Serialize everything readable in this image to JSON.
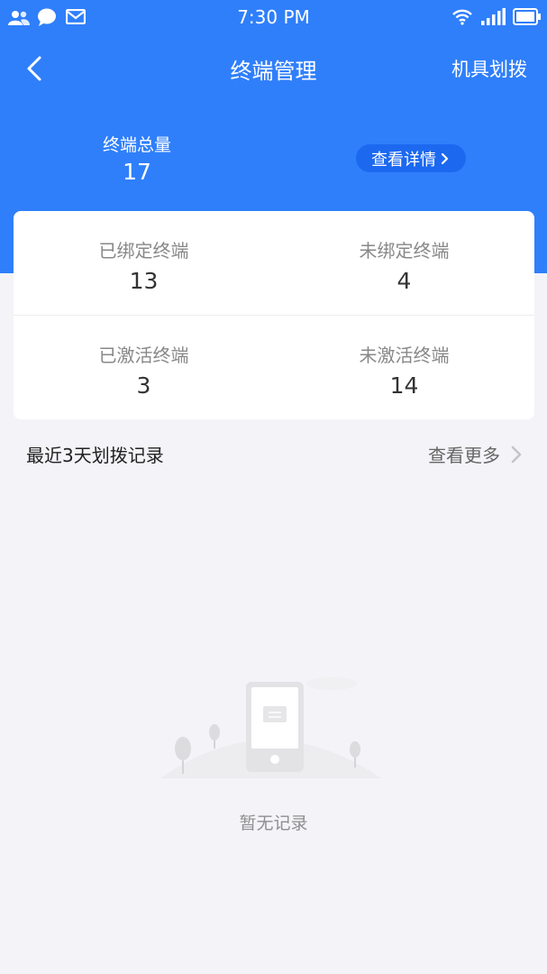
{
  "status_bar": {
    "time": "7:30 PM",
    "left_icons": [
      "people-icon",
      "chat-bubble-icon",
      "mail-icon"
    ],
    "right_icons": [
      "wifi-icon",
      "signal-icon",
      "battery-icon"
    ]
  },
  "nav": {
    "title": "终端管理",
    "action_label": "机具划拨",
    "back_icon": "chevron-left-icon"
  },
  "summary": {
    "total_label": "终端总量",
    "total_value": "17",
    "detail_button_label": "查看详情"
  },
  "stats": [
    {
      "label": "已绑定终端",
      "value": "13"
    },
    {
      "label": "未绑定终端",
      "value": "4"
    },
    {
      "label": "已激活终端",
      "value": "3"
    },
    {
      "label": "未激活终端",
      "value": "14"
    }
  ],
  "records": {
    "title": "最近3天划拨记录",
    "more_label": "查看更多",
    "empty_text": "暂无记录"
  },
  "colors": {
    "primary": "#2f7ffb",
    "button": "#1c69f0",
    "background": "#f4f4f8"
  }
}
